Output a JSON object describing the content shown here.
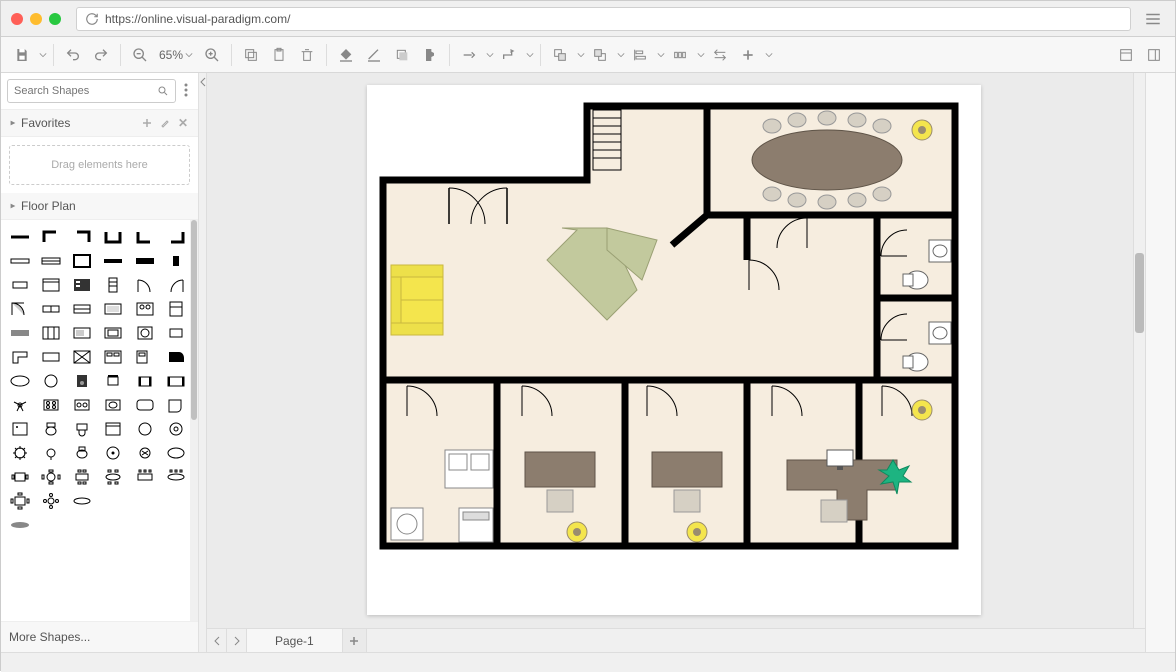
{
  "browser": {
    "url": "https://online.visual-paradigm.com/"
  },
  "toolbar": {
    "zoom_level": "65%"
  },
  "sidebar": {
    "search_placeholder": "Search Shapes",
    "favorites_label": "Favorites",
    "favorites_drop_hint": "Drag elements here",
    "floorplan_label": "Floor Plan",
    "more_shapes_label": "More Shapes..."
  },
  "tabs": {
    "page1": "Page-1"
  },
  "colors": {
    "wall": "#000000",
    "floor": "#f6eddf",
    "sofa": "#f4e54d",
    "table": "#8c7d6e",
    "counter": "#c2c99d",
    "ceiling_light_outer": "#f4e54d",
    "ceiling_light_inner": "#9a8c6f",
    "plant": "#1db481"
  }
}
